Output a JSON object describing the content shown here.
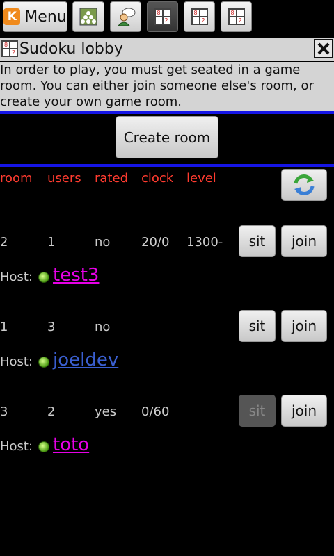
{
  "toolbar": {
    "menu_label": "Menu",
    "sudoku_digits": [
      "8",
      "1",
      "2",
      ""
    ]
  },
  "lobby": {
    "title": "Sudoku lobby",
    "intro": "In order to play, you must get seated in a game room. You can either join someone else's room, or create your own game room.",
    "create_room_label": "Create room",
    "headers": {
      "room": "room",
      "users": "users",
      "rated": "rated",
      "clock": "clock",
      "level": "level"
    },
    "host_label": "Host:",
    "rooms": [
      {
        "room": "2",
        "users": "1",
        "rated": "no",
        "clock": "20/0",
        "level": "1300-",
        "sit": "sit",
        "join": "join",
        "host": "test3",
        "host_color": "#e600e6",
        "sit_enabled": true
      },
      {
        "room": "1",
        "users": "3",
        "rated": "no",
        "clock": "",
        "level": "",
        "sit": "sit",
        "join": "join",
        "host": "joeldev",
        "host_color": "#3a5fd0",
        "sit_enabled": true
      },
      {
        "room": "3",
        "users": "2",
        "rated": "yes",
        "clock": "0/60",
        "level": "",
        "sit": "sit",
        "join": "join",
        "host": "toto",
        "host_color": "#e600e6",
        "sit_enabled": false
      }
    ]
  },
  "colors": {
    "header_text": "#ff3b2f",
    "divider": "#1515e6",
    "titlebar_bg": "#d4d4d4"
  }
}
